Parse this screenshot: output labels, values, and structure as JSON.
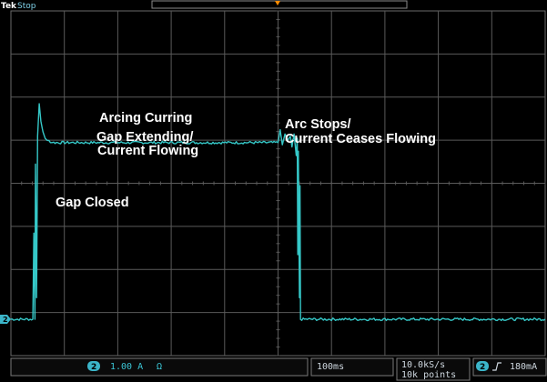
{
  "brand": "Tek",
  "run_state": "Stop",
  "colors": {
    "trace": "#35c7c7",
    "grid": "#5a5a5a",
    "badge": "#3bb5c9",
    "trigger_marker": "#ff8c00",
    "background": "#000000"
  },
  "status_bar": {
    "channel_number": "2",
    "channel_scale": "1.00 A",
    "channel_unit_symbol": "Ω",
    "timebase": "100ms",
    "sample_rate": "10.0kS/s",
    "record_length": "10k points",
    "trigger_channel": "2",
    "trigger_slope_icon": "rising-edge-icon",
    "trigger_level": "180mA"
  },
  "chart_data": {
    "type": "line",
    "title": "",
    "xlabel": "",
    "ylabel": "",
    "x_unit": "s",
    "y_unit": "A",
    "x_divisions": 10,
    "y_divisions": 8,
    "xlim": [
      -0.5,
      0.5
    ],
    "ylim": [
      -4.16,
      3.84
    ],
    "grid": true,
    "series": [
      {
        "channel": "2",
        "x": [
          -0.5,
          -0.459,
          -0.457,
          -0.455,
          -0.454,
          -0.452,
          -0.45,
          -0.447,
          -0.444,
          -0.44,
          -0.436,
          -0.432,
          -0.429,
          -0.426,
          -0.42,
          -0.35,
          -0.25,
          -0.15,
          -0.05,
          0.0,
          0.004,
          0.008,
          0.013,
          0.018,
          0.023,
          0.026,
          0.03,
          0.034,
          0.036,
          0.037,
          0.038,
          0.04,
          0.041,
          0.042,
          0.1,
          0.2,
          0.3,
          0.4,
          0.5
        ],
        "y": [
          0.0,
          0.0,
          2.0,
          0.0,
          3.6,
          0.5,
          4.25,
          5.0,
          4.6,
          4.35,
          4.2,
          4.15,
          4.15,
          4.1,
          4.1,
          4.1,
          4.1,
          4.1,
          4.1,
          4.1,
          4.4,
          4.05,
          4.3,
          4.15,
          4.25,
          4.0,
          4.3,
          3.8,
          4.2,
          1.5,
          3.9,
          0.5,
          3.1,
          0.0,
          0.0,
          0.0,
          0.0,
          0.0,
          0.0
        ]
      }
    ],
    "annotations": [
      "Arcing Curring",
      "Gap Extending/",
      "Current Flowing",
      "Gap Closed",
      "Arc Stops/",
      "Current Ceases Flowing"
    ]
  }
}
